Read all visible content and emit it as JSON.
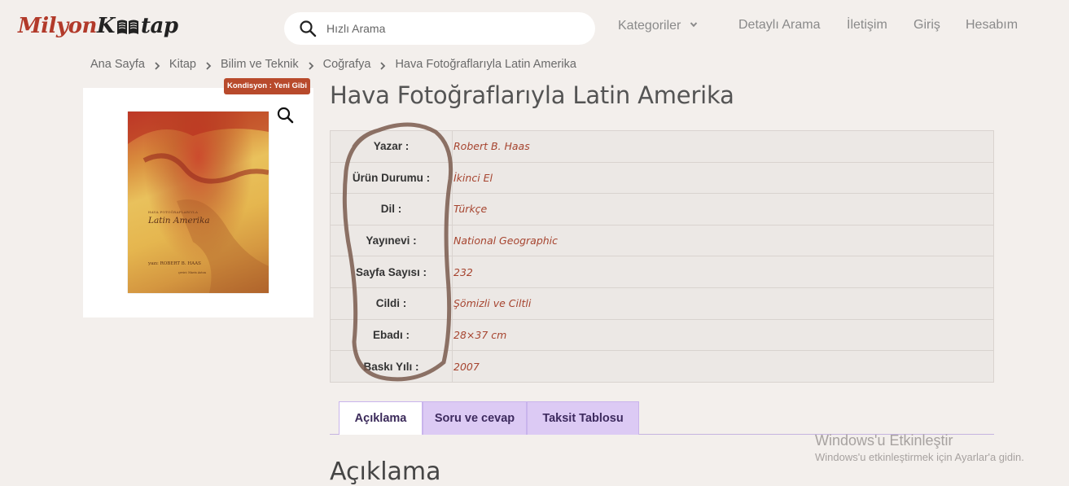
{
  "header": {
    "logo": {
      "part1": "Milyon",
      "part2": "tap",
      "book_letter": "K"
    },
    "search": {
      "placeholder": "Hızlı Arama",
      "value": ""
    },
    "nav": {
      "categories": "Kategoriler",
      "detailed_search": "Detaylı Arama",
      "contact": "İletişim",
      "login": "Giriş",
      "account": "Hesabım"
    }
  },
  "breadcrumb": [
    "Ana Sayfa",
    "Kitap",
    "Bilim ve Teknik",
    "Coğrafya",
    "Hava Fotoğraflarıyla Latin Amerika"
  ],
  "product": {
    "condition_badge": "Kondisyon : Yeni Gibi",
    "title": "Hava Fotoğraflarıyla Latin Amerika",
    "cover": {
      "small_text": "HAVA FOTOĞRAFLARIYLA",
      "title": "Latin Amerika",
      "author": "yazı: ROBERT B. HAAS",
      "sub": "çeviri: Mavis Aston"
    },
    "details": [
      {
        "label": "Yazar :",
        "value": "Robert B. Haas"
      },
      {
        "label": "Ürün Durumu :",
        "value": "İkinci El"
      },
      {
        "label": "Dil :",
        "value": "Türkçe"
      },
      {
        "label": "Yayınevi :",
        "value": "National Geographic"
      },
      {
        "label": "Sayfa Sayısı :",
        "value": "232"
      },
      {
        "label": "Cildi :",
        "value": "Şömizli ve Ciltli"
      },
      {
        "label": "Ebadı :",
        "value": "28×37 cm"
      },
      {
        "label": "Baskı Yılı :",
        "value": "2007"
      }
    ]
  },
  "tabs": [
    {
      "label": "Açıklama",
      "active": true
    },
    {
      "label": "Soru ve cevap",
      "active": false
    },
    {
      "label": "Taksit Tablosu",
      "active": false
    }
  ],
  "section_heading": "Açıklama",
  "windows_watermark": {
    "line1": "Windows'u Etkinleştir",
    "line2": "Windows'u etkinleştirmek için Ayarlar'a gidin."
  },
  "colors": {
    "background": "#f3efec",
    "accent_red": "#b23a2a",
    "value_text": "#a6442f",
    "tab_purple": "#dccaf4",
    "annotation_brown": "#7a5a4e"
  }
}
